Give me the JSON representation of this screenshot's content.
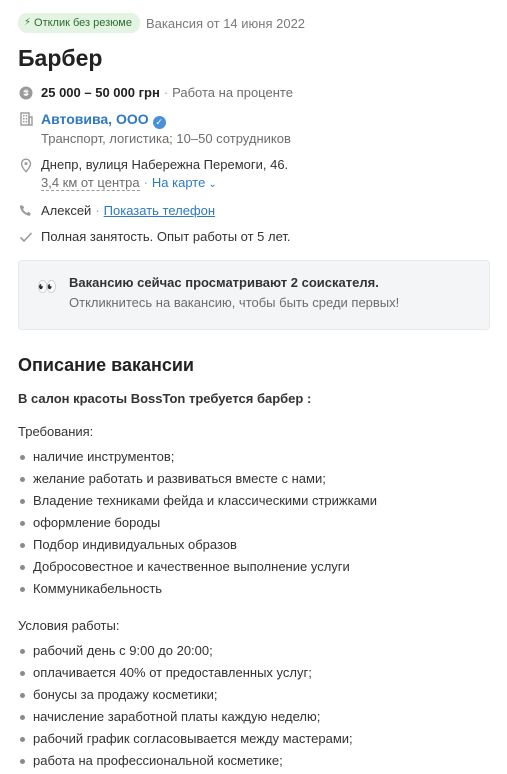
{
  "header": {
    "badge_label": "Отклик без резюме",
    "posted": "Вакансия от 14 июня 2022",
    "title": "Барбер"
  },
  "salary": {
    "range": "25 000 – 50 000 грн",
    "type": "Работа на проценте"
  },
  "company": {
    "name": "Автовива, ООО",
    "meta": "Транспорт, логистика; 10–50 сотрудников"
  },
  "address": {
    "text": "Днепр, вулиця Набережна Перемоги, 46.",
    "distance": "3,4 км от центра",
    "map_link": "На карте"
  },
  "contact": {
    "name": "Алексей",
    "phone_link": "Показать телефон"
  },
  "employment": {
    "text": "Полная занятость. Опыт работы от 5 лет."
  },
  "notice": {
    "title": "Вакансию сейчас просматривают 2 соискателя.",
    "subtitle": "Откликнитесь на вакансию, чтобы быть среди первых!"
  },
  "description": {
    "heading": "Описание вакансии",
    "intro": "В салон красоты BossTon требуется барбер :",
    "requirements_label": "Требования:",
    "requirements": [
      "наличие инструментов;",
      "желание работать и развиваться вместе с нами;",
      "Владение техниками фейда и классическими стрижками",
      "оформление бороды",
      "Подбор индивидуальных образов",
      "Добросовестное и качественное выполнение услуги",
      "Коммуникабельность"
    ],
    "conditions_label": "Условия работы:",
    "conditions": [
      "рабочий день с 9:00 до 20:00;",
      "оплачивается 40% от предоставленных услуг;",
      "бонусы за продажу косметики;",
      "начисление заработной платы каждую неделю;",
      "рабочий график согласовывается между мастерами;",
      "работа на профессиональной косметике;"
    ]
  },
  "icons": {
    "salary": "hryvnia-coin-icon",
    "company": "building-icon",
    "address": "location-pin-icon",
    "contact": "phone-icon",
    "employment": "check-icon",
    "notice": "eyes-icon"
  },
  "colors": {
    "link": "#2f79c2",
    "badge_bg": "#e3f4e3",
    "notice_bg": "#f4f5f6"
  }
}
